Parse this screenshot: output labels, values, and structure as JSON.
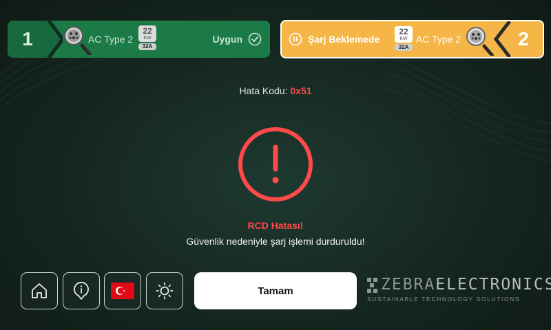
{
  "connectors": [
    {
      "number": "1",
      "type": "AC Type 2",
      "power": "22",
      "power_unit": "KW",
      "current": "32A",
      "status": "Uygun"
    },
    {
      "number": "2",
      "type": "AC Type 2",
      "power": "22",
      "power_unit": "KW",
      "current": "32A",
      "status": "Şarj Beklemede"
    }
  ],
  "error": {
    "code_label": "Hata Kodu:",
    "code": "0x51",
    "title": "RCD Hatası!",
    "message": "Güvenlik nedeniyle şarj işlemi durduruldu!"
  },
  "toolbar": {
    "ok_label": "Tamam",
    "icons": [
      "home-icon",
      "info-icon",
      "turkey-flag-icon",
      "brightness-icon"
    ]
  },
  "brand": {
    "name_part1": "ZEBRA",
    "name_part2": "ELECTRONICS",
    "tagline": "SUSTAINABLE TECHNOLOGY SOLUTIONS"
  },
  "colors": {
    "available": "#1b7a46",
    "waiting": "#f5b547",
    "error": "#ff4a4a",
    "background": "#15261f"
  }
}
